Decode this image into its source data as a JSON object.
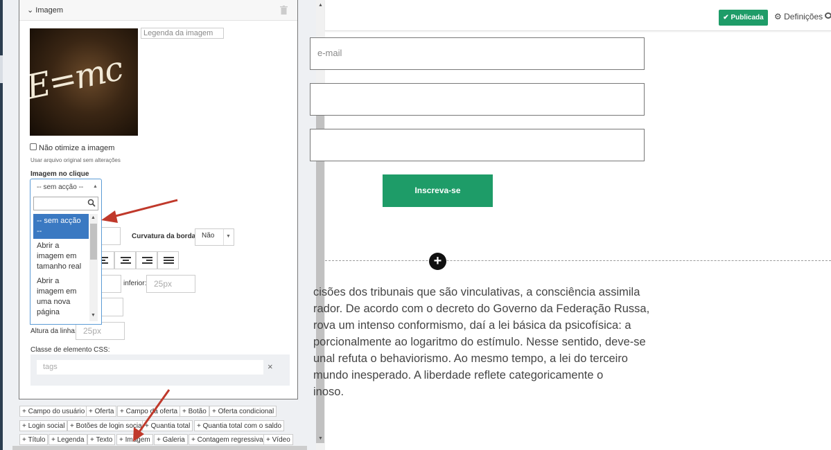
{
  "editor": {
    "section_title": "Imagem",
    "caption_placeholder": "Legenda da imagem",
    "thumbnail_text": "E=mc",
    "optimize_label": "Não otimize a imagem",
    "optimize_hint": "Usar arquivo original sem alterações",
    "click_label": "Imagem no clique",
    "select_value": "-- sem acção --",
    "dropdown_options": [
      "-- sem acção --",
      "Abrir a imagem em tamanho real",
      "Abrir a imagem em uma nova página"
    ],
    "border_label": "Curvatura da borda:",
    "border_value": "Não",
    "inferior_label": "inferior:",
    "inferior_value": "25px",
    "line_height_label": "Altura da linha:",
    "line_height_value": "25px",
    "css_label": "Classe de elemento CSS:",
    "tags_placeholder": "tags",
    "tags_clear": "×"
  },
  "chips": [
    [
      "+ Campo do usuário",
      "+ Oferta",
      "+ Campo da oferta",
      "+ Botão",
      "+ Oferta condicional"
    ],
    [
      "+ Login social",
      "+ Botões de login social",
      "+ Quantia total",
      "+ Quantia total com o saldo"
    ],
    [
      "+ Título",
      "+ Legenda",
      "+ Texto",
      "+ Imagem",
      "+ Galeria",
      "+ Contagem regressiva",
      "+ Vídeo"
    ]
  ],
  "topbar": {
    "publish_label": "Publicada",
    "settings_label": "Definições"
  },
  "preview": {
    "email_placeholder": "e-mail",
    "subscribe_label": "Inscreva-se",
    "add_symbol": "+",
    "body_text": "cisões dos tribunais que são vinculativas, a consciência assimila\nrador. De acordo com o decreto do Governo da Federação Russa,\nrova um intenso conformismo, daí a lei básica da psicofísica: a\nporcionalmente ao logaritmo do estímulo. Nesse sentido, deve-se\nunal refuta o behaviorismo. Ao mesmo tempo, a lei do terceiro\nmundo inesperado. A liberdade reflete categoricamente o\ninoso."
  },
  "colors": {
    "accent_green": "#1e9c68",
    "selection_blue": "#3a79c2",
    "annotation_red": "#c0392b"
  }
}
